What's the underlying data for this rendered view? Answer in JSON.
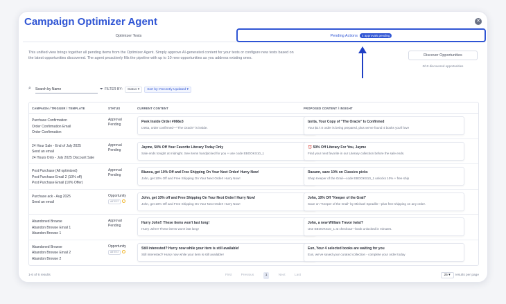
{
  "header": {
    "title": "Campaign Optimizer Agent",
    "close_icon": "close-icon"
  },
  "tabs": [
    {
      "label": "Optimizer Tests"
    },
    {
      "label": "Pending Actions",
      "badge": "4 approvals pending"
    }
  ],
  "intro": "This unified view brings together all pending items from the Optimizer Agent. Simply approve AI-generated content for your tests or configure new tests based on the latest opportunities discovered. The agent proactively fills the pipeline with up to 10 new opportunities as you address existing ones.",
  "discover": {
    "button": "Discover Opportunities",
    "count": "0/10 discovered opportunities"
  },
  "search": {
    "value": "Search by Name"
  },
  "filters": {
    "label": "FILTER BY:",
    "status": "Status ▾",
    "sort": "Sort by: Recently Updated ▾"
  },
  "table": {
    "headers": {
      "campaign": "CAMPAIGN / TRIGGER / TEMPLATE",
      "status": "STATUS",
      "current": "CURRENT CONTENT",
      "proposed": "PROPOSED CONTENT / INSIGHT"
    },
    "rows": [
      {
        "names": [
          "Purchase Confirmation",
          "Order Confirmation Email",
          "Order Confirmation"
        ],
        "status1": "Approval",
        "status2": "Pending",
        "current_title": "Peek Inside Order #066e3",
        "current_body": "Izetta, order confirmed—\"The Oracle\" is inside.",
        "proposed_title": "Izetta, Your Copy of \"The Oracle\" Is Confirmed",
        "proposed_body": "Your $17.0 order is being prepared, plus we've found 4 books you'll love"
      },
      {
        "names": [
          "24 Hour Sale - End of July 2025",
          "Send an email",
          "24 Hours Only - July 2025 Discount Sale"
        ],
        "status1": "Approval",
        "status2": "Pending",
        "current_title": "Jayme, 50% Off Your Favorite Literary Today Only",
        "current_body": "Sale ends tonight at midnight. See items handpicked for you + use code EBOOKS10_1",
        "proposed_title": "⏰ 50% Off Literary For You, Jayme",
        "proposed_body": "Find your next favorite in our Literary collection before the sale ends."
      },
      {
        "names": [
          "Post Purchase (All optimized)",
          "Post Purchase Email 2 (10% off)",
          "Post Purchase Email (10% Offer)"
        ],
        "status1": "Approval",
        "status2": "Pending",
        "current_title": "Bianca, get 10% Off and Free Shipping On Your Next Order! Hurry Now!",
        "current_body": "John, get 10% Off and Free Shipping On Your Next Order! Hurry Now!",
        "proposed_title": "Raeann, save 10% on Classics picks",
        "proposed_body": "Shop Keeper of the Grail—code EBOOKS10_1 unlocks 10% + free ship"
      },
      {
        "names": [
          "Purchase ack - Aug 2025",
          "Send an email"
        ],
        "status1": "Opportunity",
        "status2": "",
        "tag": "ABTEST",
        "current_title": "John, get 10% off and Free Shipping On Your Next Order! Hurry Now!",
        "current_body": "John, get 10% Off and Free Shipping On Your Next Order! Hurry Now!",
        "proposed_title": "John, 10% Off \"Keeper of the Grail\"",
        "proposed_body": "Save on \"Keeper of the Grail\" by Michael Spradlin—plus free shipping on any order."
      },
      {
        "names": [
          "Abandoned Browse",
          "Abandon Browse Email 1",
          "Abandon Browse 1"
        ],
        "status1": "Approval",
        "status2": "Pending",
        "current_title": "Hurry John!! These items won't last long!",
        "current_body": "Hurry John!! These items won't last long!",
        "proposed_title": "John, a new William Trevor twist?",
        "proposed_body": "Use EBOOKS10_1 at checkout—book unlocked in minutes."
      },
      {
        "names": [
          "Abandoned Browse",
          "Abandon Browse Email 2",
          "Abandon Browse 2"
        ],
        "status1": "Opportunity",
        "status2": "",
        "tag": "ABTEST",
        "current_title": "Still interested? Hurry now while your item is still available!",
        "current_body": "Still interested? Hurry now while your item is still available!",
        "proposed_title": "Eun, Your 4 selected books are waiting for you",
        "proposed_body": "Eun, we've saved your curated collection - complete your order today"
      }
    ]
  },
  "footer": {
    "count": "1-6 of 6 results",
    "pager": [
      "First",
      "Previous",
      "1",
      "Next",
      "Last"
    ],
    "per_page_value": "25",
    "per_page_label": "results per page"
  }
}
